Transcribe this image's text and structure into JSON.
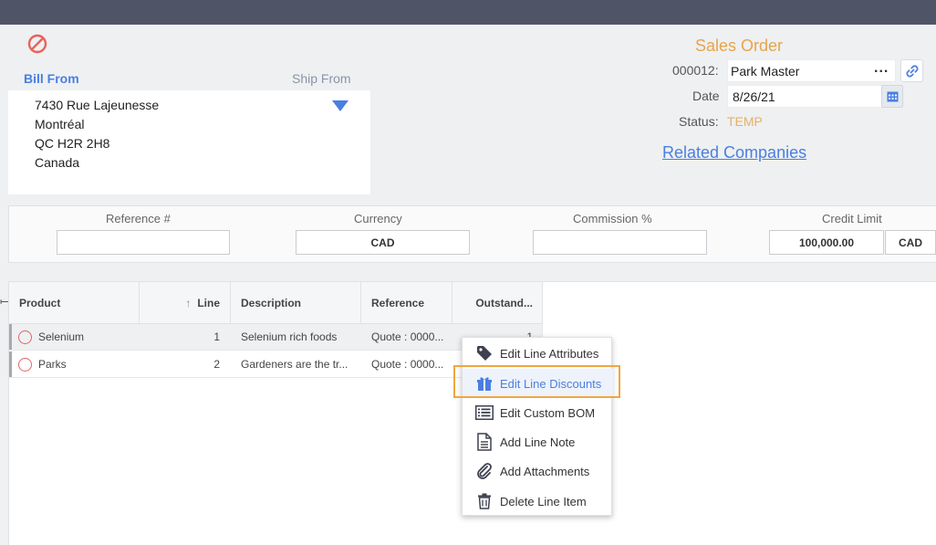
{
  "header": {
    "tab_bill_from": "Bill From",
    "tab_ship_from": "Ship From"
  },
  "address": {
    "lines": [
      "7430 Rue Lajeunesse",
      "Montréal",
      "QC H2R 2H8",
      "Canada"
    ]
  },
  "order": {
    "title": "Sales Order",
    "number_label": "000012:",
    "customer": "Park Master",
    "more_label": "...",
    "date_label": "Date",
    "date_value": "8/26/21",
    "status_label": "Status:",
    "status_value": "TEMP",
    "related_link": "Related Companies"
  },
  "fields": {
    "reference_label": "Reference #",
    "reference_value": "",
    "currency_label": "Currency",
    "currency_value": "CAD",
    "commission_label": "Commission %",
    "commission_value": "",
    "credit_limit_label": "Credit Limit",
    "credit_limit_value": "100,000.00",
    "credit_currency": "CAD"
  },
  "grid": {
    "columns": [
      "Product",
      "Line",
      "Description",
      "Reference",
      "Outstand..."
    ],
    "line_sort_indicator": "↑",
    "rows": [
      {
        "product": "Selenium",
        "line": "1",
        "description": "Selenium rich foods",
        "reference": "Quote : 0000...",
        "outstanding": "1"
      },
      {
        "product": "Parks",
        "line": "2",
        "description": "Gardeners are the tr...",
        "reference": "Quote : 0000...",
        "outstanding": ""
      }
    ]
  },
  "context_menu": {
    "items": [
      {
        "label": "Edit Line Attributes",
        "icon": "tag-icon"
      },
      {
        "label": "Edit Line Discounts",
        "icon": "gift-icon"
      },
      {
        "label": "Edit Custom BOM",
        "icon": "list-icon"
      },
      {
        "label": "Add Line Note",
        "icon": "document-icon"
      },
      {
        "label": "Add Attachments",
        "icon": "paperclip-icon"
      },
      {
        "label": "Delete Line Item",
        "icon": "trash-icon"
      }
    ]
  },
  "colors": {
    "accent_blue": "#4a7fe0",
    "orange": "#e8a44a",
    "topbar": "#4f5566",
    "highlight_border": "#f0a63e"
  }
}
